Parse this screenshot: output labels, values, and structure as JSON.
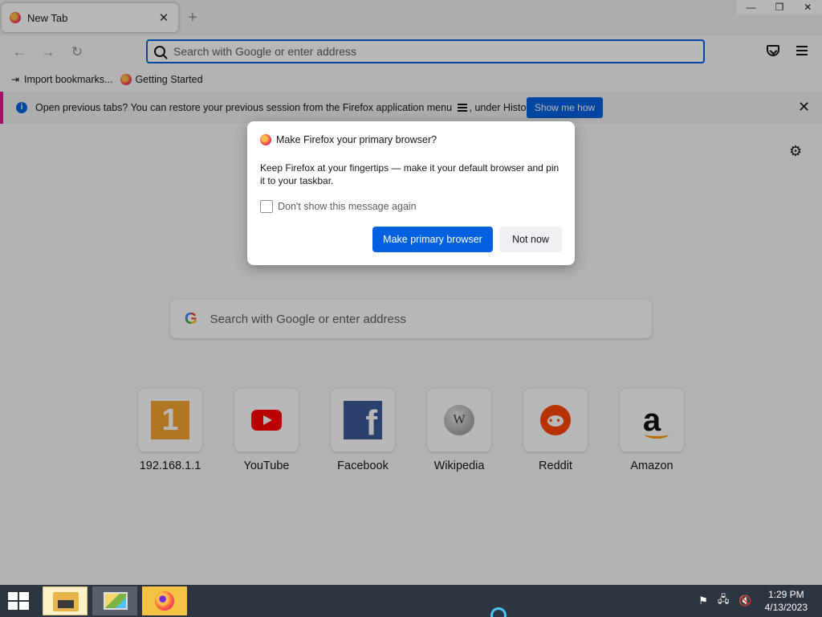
{
  "tab": {
    "title": "New Tab",
    "close": "✕",
    "new_tab": "+"
  },
  "window_controls": {
    "minimize": "—",
    "restore": "❐",
    "close": "✕"
  },
  "nav": {
    "back": "←",
    "forward": "→",
    "reload": "↻",
    "url_placeholder": "Search with Google or enter address"
  },
  "bookmarks": [
    {
      "label": "Import bookmarks...",
      "icon": "import-icon"
    },
    {
      "label": "Getting Started",
      "icon": "firefox-icon"
    }
  ],
  "infobar": {
    "message_before": "Open previous tabs? You can restore your previous session from the Firefox application menu",
    "message_after": ", under History.",
    "button": "Show me how",
    "close": "✕"
  },
  "content": {
    "settings": "⚙",
    "search_g": "G",
    "search_placeholder": "Search with Google or enter address",
    "sites": [
      {
        "label": "192.168.1.1",
        "icon": "1"
      },
      {
        "label": "YouTube",
        "icon": "youtube-icon"
      },
      {
        "label": "Facebook",
        "icon": "f"
      },
      {
        "label": "Wikipedia",
        "icon": "W"
      },
      {
        "label": "Reddit",
        "icon": "reddit-icon"
      },
      {
        "label": "Amazon",
        "icon": "a"
      }
    ]
  },
  "dialog": {
    "title": "Make Firefox your primary browser?",
    "body": "Keep Firefox at your fingertips — make it your default browser and pin it to your taskbar.",
    "checkbox_label": "Don't show this message again",
    "primary_button": "Make primary browser",
    "secondary_button": "Not now"
  },
  "taskbar": {
    "time": "1:29 PM",
    "date": "4/13/2023",
    "tray_flag": "⚑",
    "tray_network": "🖧",
    "tray_volume": "🔇"
  },
  "colors": {
    "accent": "#0061e0",
    "infobar_stripe": "#e31587"
  }
}
